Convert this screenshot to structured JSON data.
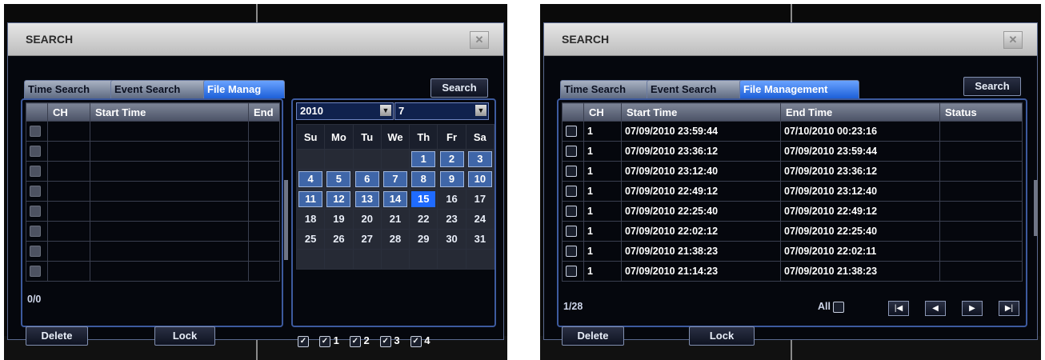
{
  "screens": [
    {
      "title": "SEARCH",
      "close_glyph": "✕",
      "tabs": [
        {
          "label": "Time Search",
          "active": false
        },
        {
          "label": "Event Search",
          "active": false
        },
        {
          "label": "File Manag",
          "active": true
        }
      ],
      "search_label": "Search",
      "columns": [
        "",
        "CH",
        "Start Time",
        "End"
      ],
      "rows": 8,
      "page_info": "0/0",
      "delete_label": "Delete",
      "lock_label": "Lock",
      "calendar": {
        "year": "2010",
        "month": "7",
        "weekdays": [
          "Su",
          "Mo",
          "Tu",
          "We",
          "Th",
          "Fr",
          "Sa"
        ],
        "weeks": [
          [
            "",
            "",
            "",
            "",
            "1",
            "2",
            "3"
          ],
          [
            "4",
            "5",
            "6",
            "7",
            "8",
            "9",
            "10"
          ],
          [
            "11",
            "12",
            "13",
            "14",
            "15",
            "16",
            "17"
          ],
          [
            "18",
            "19",
            "20",
            "21",
            "22",
            "23",
            "24"
          ],
          [
            "25",
            "26",
            "27",
            "28",
            "29",
            "30",
            "31"
          ],
          [
            "",
            "",
            "",
            "",
            "",
            "",
            ""
          ]
        ],
        "recorded_days": [
          "1",
          "2",
          "3",
          "4",
          "5",
          "6",
          "7",
          "8",
          "9",
          "10",
          "11",
          "12",
          "13",
          "14"
        ],
        "today": "15",
        "channels": [
          "",
          "1",
          "2",
          "3",
          "4"
        ]
      }
    },
    {
      "title": "SEARCH",
      "close_glyph": "✕",
      "tabs": [
        {
          "label": "Time Search",
          "active": false
        },
        {
          "label": "Event Search",
          "active": false
        },
        {
          "label": "File Management",
          "active": true
        }
      ],
      "search_label": "Search",
      "columns": [
        "",
        "CH",
        "Start Time",
        "End Time",
        "Status"
      ],
      "rows": [
        {
          "ch": "1",
          "start": "07/09/2010 23:59:44",
          "end": "07/10/2010 00:23:16",
          "status": ""
        },
        {
          "ch": "1",
          "start": "07/09/2010 23:36:12",
          "end": "07/09/2010 23:59:44",
          "status": ""
        },
        {
          "ch": "1",
          "start": "07/09/2010 23:12:40",
          "end": "07/09/2010 23:36:12",
          "status": ""
        },
        {
          "ch": "1",
          "start": "07/09/2010 22:49:12",
          "end": "07/09/2010 23:12:40",
          "status": ""
        },
        {
          "ch": "1",
          "start": "07/09/2010 22:25:40",
          "end": "07/09/2010 22:49:12",
          "status": ""
        },
        {
          "ch": "1",
          "start": "07/09/2010 22:02:12",
          "end": "07/09/2010 22:25:40",
          "status": ""
        },
        {
          "ch": "1",
          "start": "07/09/2010 21:38:23",
          "end": "07/09/2010 22:02:11",
          "status": ""
        },
        {
          "ch": "1",
          "start": "07/09/2010 21:14:23",
          "end": "07/09/2010 21:38:23",
          "status": ""
        }
      ],
      "page_info": "1/28",
      "all_label": "All",
      "nav": [
        "first-page",
        "prev-page",
        "next-page",
        "last-page"
      ],
      "delete_label": "Delete",
      "lock_label": "Lock"
    }
  ]
}
